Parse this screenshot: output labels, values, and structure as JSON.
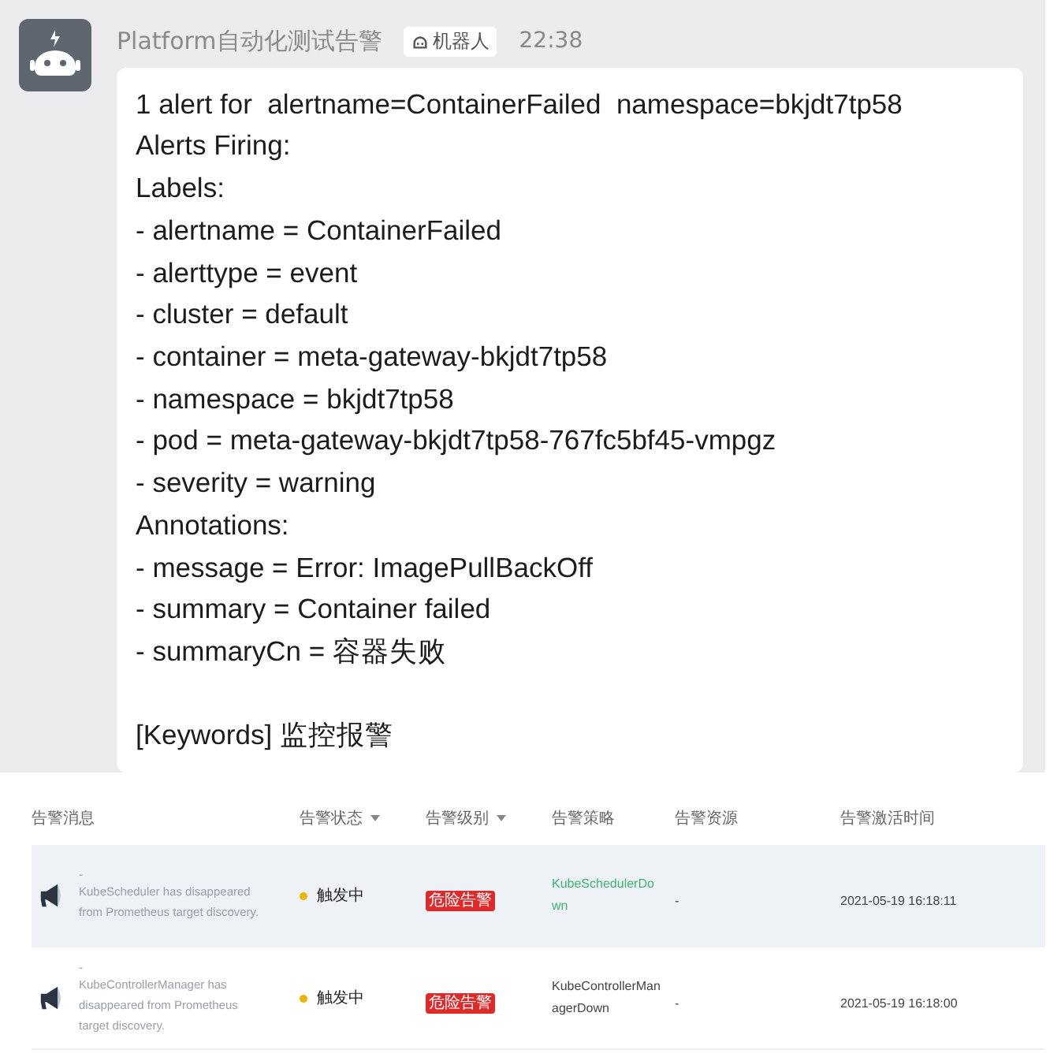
{
  "message": {
    "sender": "Platform自动化测试告警",
    "badge": "机器人",
    "time": "22:38",
    "lines": [
      "1 alert for  alertname=ContainerFailed  namespace=bkjdt7tp58",
      "Alerts Firing:",
      "Labels:",
      "- alertname = ContainerFailed",
      "- alerttype = event",
      "- cluster = default",
      "- container = meta-gateway-bkjdt7tp58",
      "- namespace = bkjdt7tp58",
      "- pod = meta-gateway-bkjdt7tp58-767fc5bf45-vmpgz",
      "- severity = warning",
      "Annotations:",
      "- message = Error: ImagePullBackOff",
      "- summary = Container failed",
      "- summaryCn = 容器失败"
    ],
    "keywords": "[Keywords] 监控报警"
  },
  "table": {
    "columns": [
      {
        "label": "告警消息",
        "sortable": false
      },
      {
        "label": "告警状态",
        "sortable": true
      },
      {
        "label": "告警级别",
        "sortable": true
      },
      {
        "label": "告警策略",
        "sortable": false
      },
      {
        "label": "告警资源",
        "sortable": false
      },
      {
        "label": "告警激活时间",
        "sortable": false
      }
    ],
    "rows": [
      {
        "selected": true,
        "title": "-",
        "description": "KubeScheduler has disappeared from Prometheus target discovery.",
        "status": "触发中",
        "severity": "危险告警",
        "policy": "KubeSchedulerDown",
        "resource": "-",
        "time": "2021-05-19 16:18:11"
      },
      {
        "selected": false,
        "title": "-",
        "description": "KubeControllerManager has disappeared from Prometheus target discovery.",
        "status": "触发中",
        "severity": "危险告警",
        "policy": "KubeControllerManagerDown",
        "resource": "-",
        "time": "2021-05-19 16:18:00"
      }
    ]
  }
}
